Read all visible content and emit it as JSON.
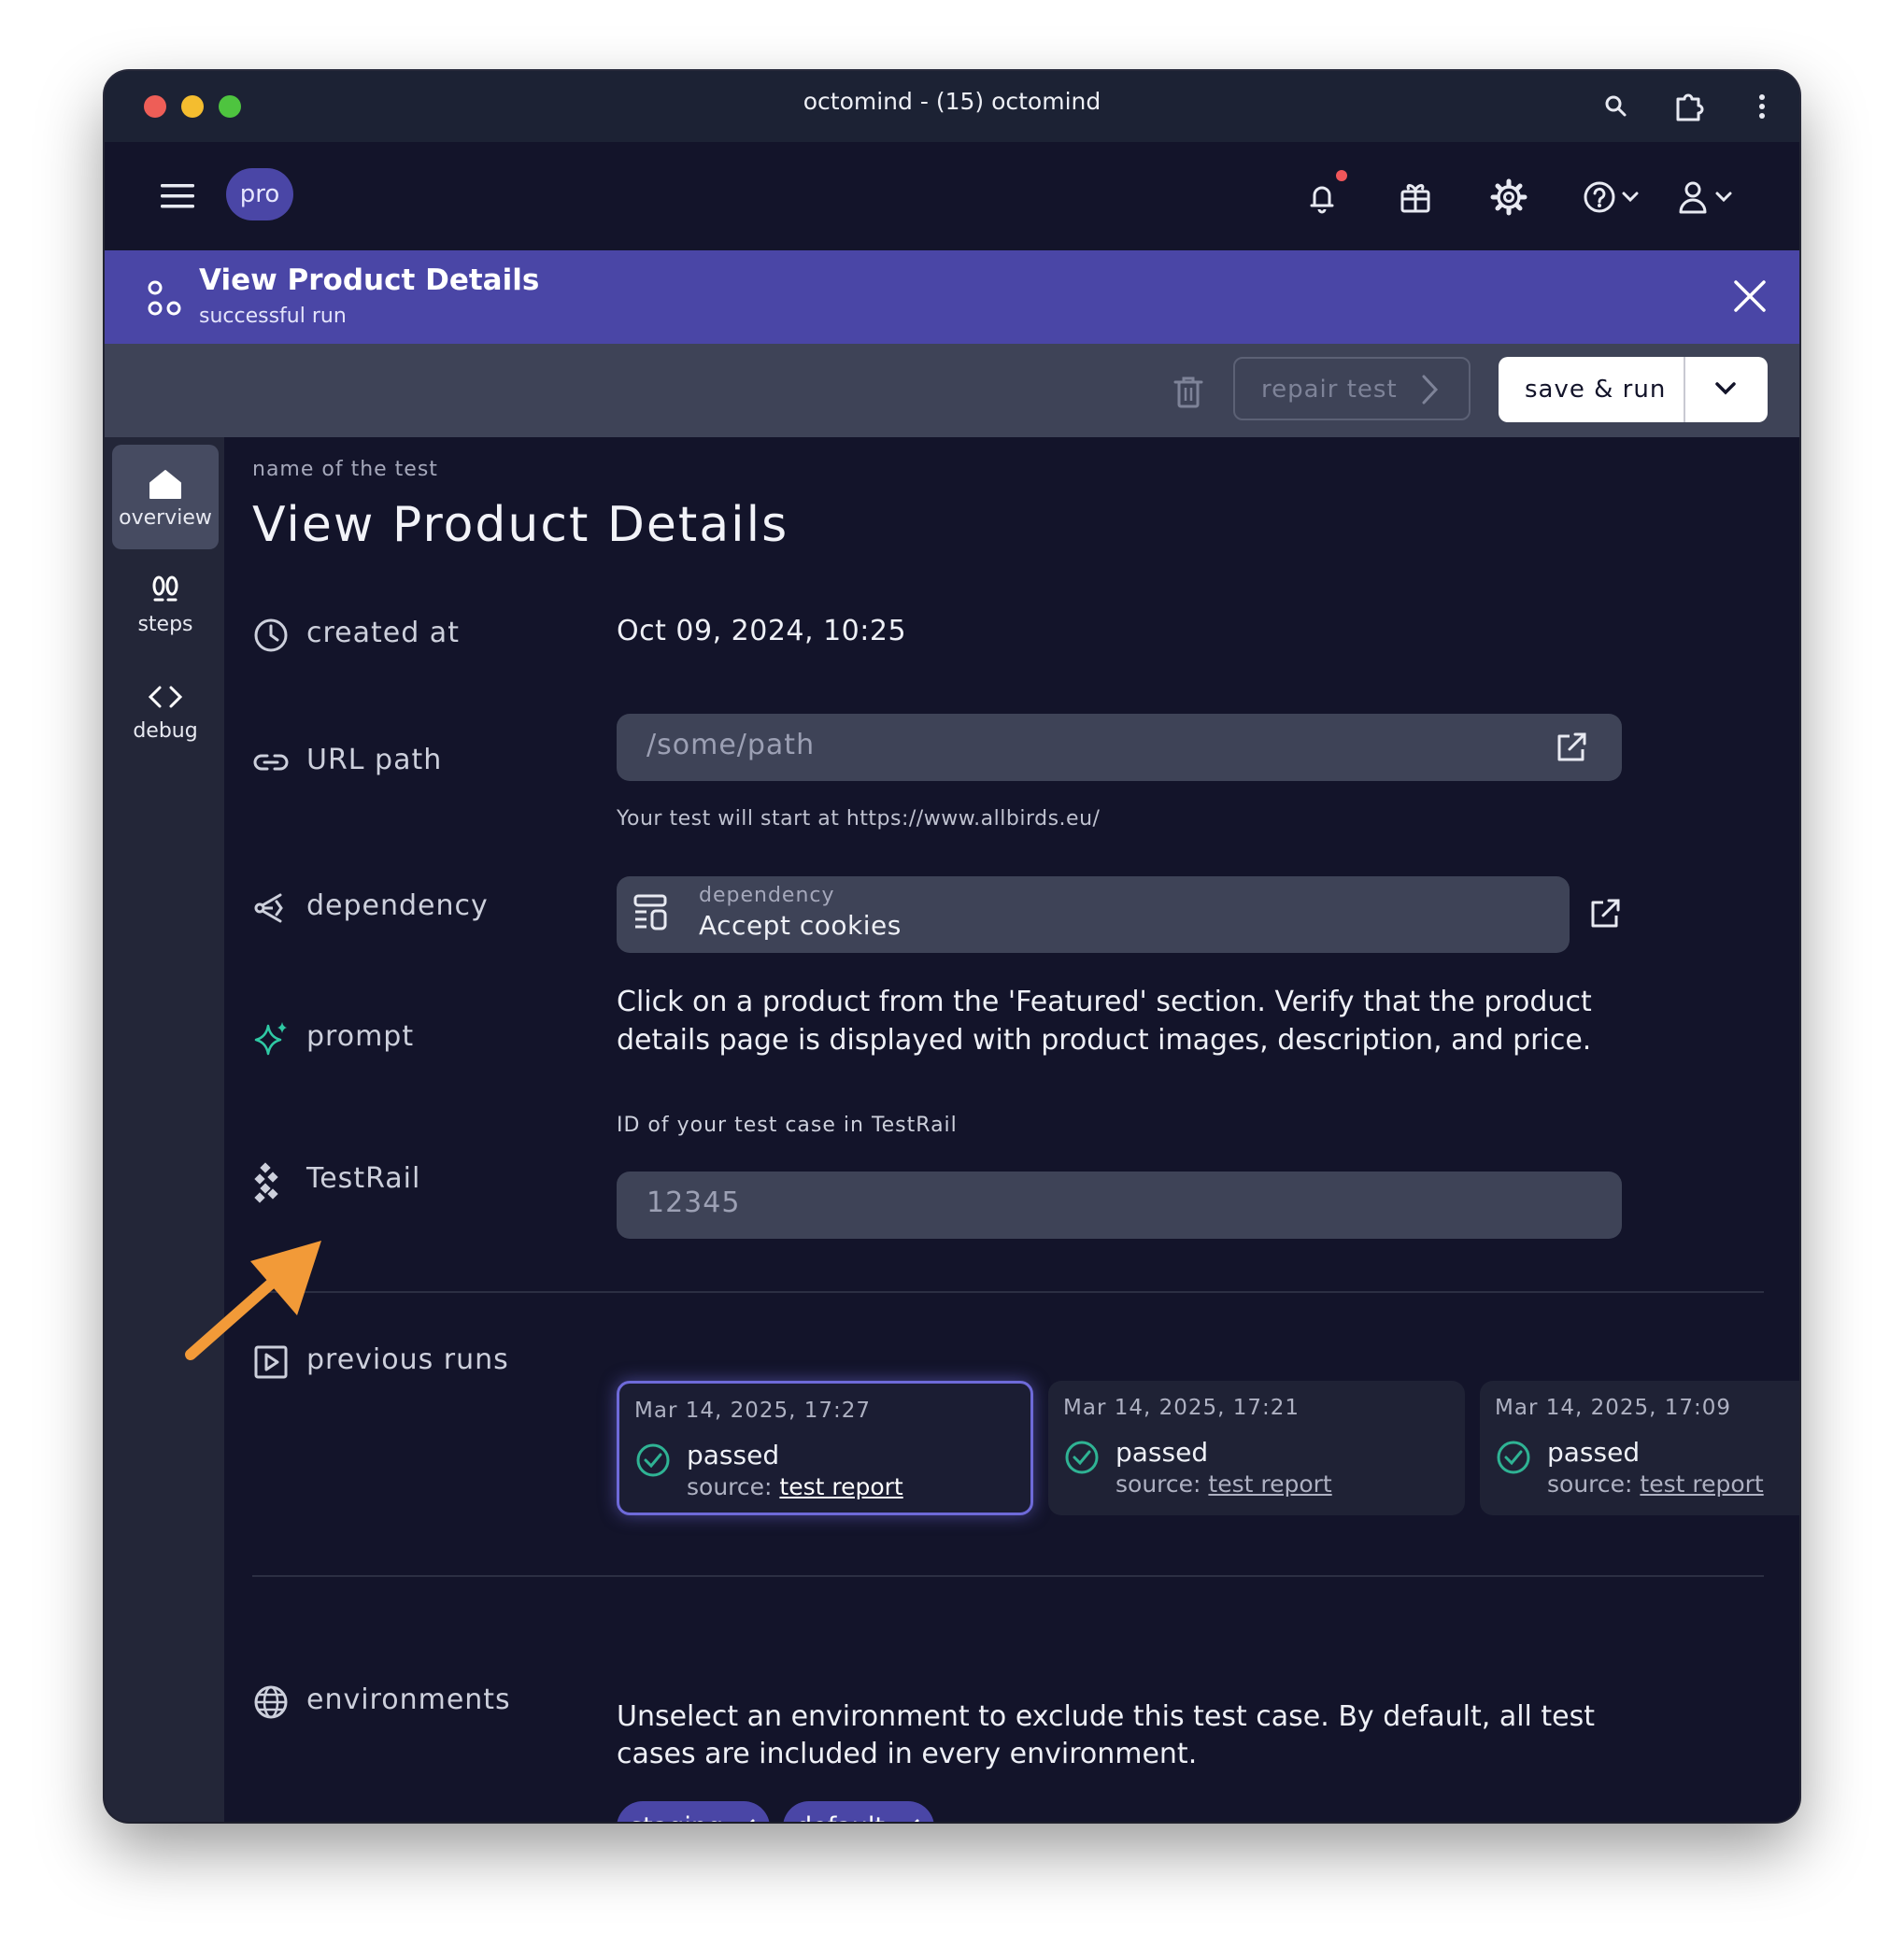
{
  "window": {
    "title": "octomind - (15) octomind"
  },
  "topnav": {
    "plan_badge": "pro"
  },
  "banner": {
    "title": "View Product Details",
    "subtitle": "successful run"
  },
  "toolbar": {
    "repair_label": "repair test",
    "save_label": "save & run"
  },
  "sidebar": {
    "items": [
      {
        "label": "overview",
        "icon": "home-icon",
        "active": true
      },
      {
        "label": "steps",
        "icon": "footsteps-icon",
        "active": false
      },
      {
        "label": "debug",
        "icon": "code-icon",
        "active": false
      }
    ]
  },
  "test": {
    "name_caption": "name of the test",
    "name": "View Product Details",
    "created_label": "created at",
    "created_value": "Oct 09, 2024, 10:25",
    "url_label": "URL path",
    "url_placeholder": "/some/path",
    "url_help": "Your test will start at https://www.allbirds.eu/",
    "dependency_label": "dependency",
    "dependency_caption": "dependency",
    "dependency_value": "Accept cookies",
    "prompt_label": "prompt",
    "prompt_text": "Click on a product from the 'Featured' section. Verify that the product details page is displayed with product images, description, and price.",
    "testrail_label": "TestRail",
    "testrail_caption": "ID of your test case in TestRail",
    "testrail_placeholder": "12345"
  },
  "previous_runs": {
    "label": "previous runs",
    "runs": [
      {
        "date": "Mar 14, 2025, 17:27",
        "status": "passed",
        "source_label": "source:",
        "source_link": "test report"
      },
      {
        "date": "Mar 14, 2025, 17:21",
        "status": "passed",
        "source_label": "source:",
        "source_link": "test report"
      },
      {
        "date": "Mar 14, 2025, 17:09",
        "status": "passed",
        "source_label": "source:",
        "source_link": "test report"
      }
    ]
  },
  "environments": {
    "label": "environments",
    "help": "Unselect an environment to exclude this test case. By default, all test cases are included in every environment.",
    "chips": [
      "staging",
      "default"
    ]
  },
  "colors": {
    "accent": "#4a46a6",
    "background": "#13142a",
    "success": "#2fb394",
    "annotation_arrow": "#f29a38"
  }
}
